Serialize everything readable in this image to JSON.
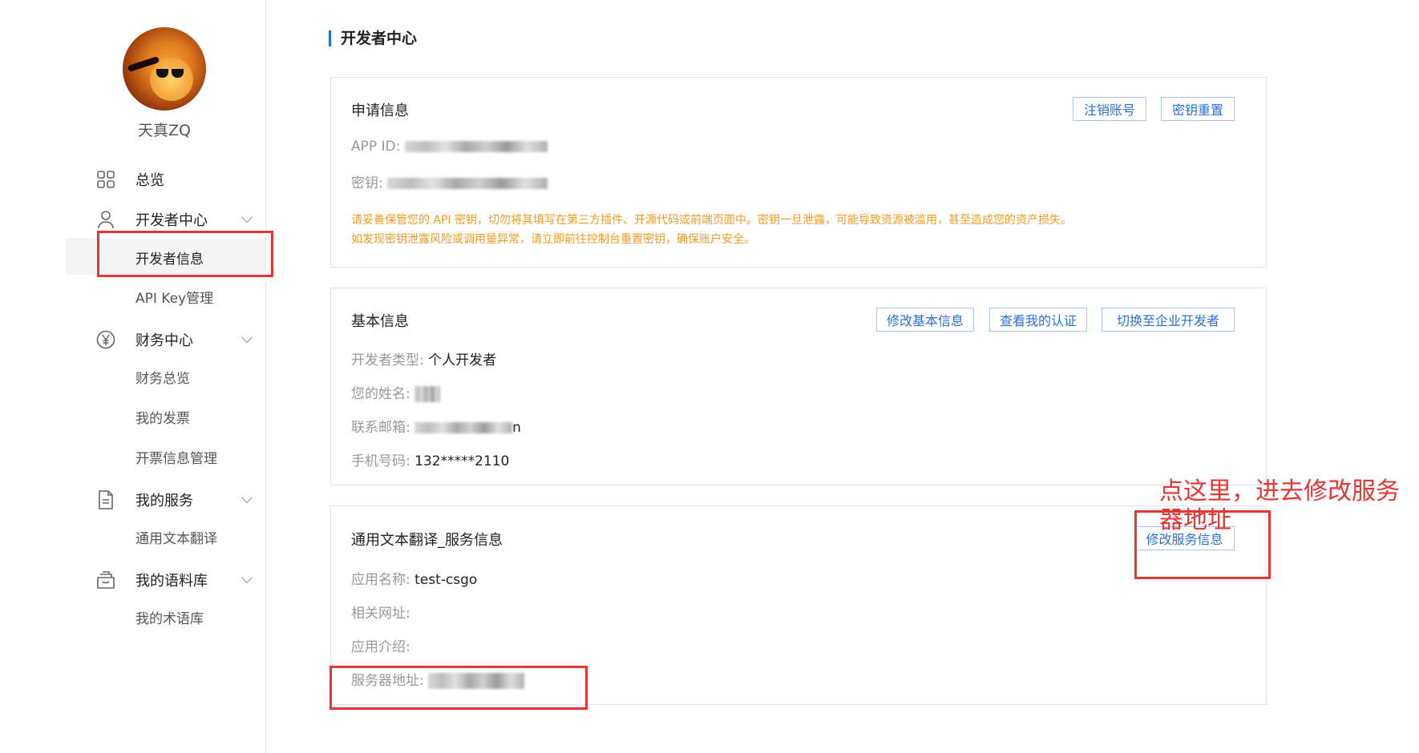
{
  "user": {
    "name": "天真ZQ"
  },
  "nav": {
    "overview": "总览",
    "developer_center": "开发者中心",
    "developer_info": "开发者信息",
    "api_key_mgmt": "API Key管理",
    "finance_center": "财务中心",
    "finance_overview": "财务总览",
    "my_invoices": "我的发票",
    "invoice_info_mgmt": "开票信息管理",
    "my_services": "我的服务",
    "general_text_translation": "通用文本翻译",
    "my_corpus": "我的语料库",
    "my_termbase": "我的术语库"
  },
  "page": {
    "title": "开发者中心"
  },
  "application": {
    "title": "申请信息",
    "app_id_label": "APP ID:",
    "secret_label": "密钥:",
    "btn_cancel_account": "注销账号",
    "btn_reset_key": "密钥重置",
    "warning_line1": "请妥善保管您的 API 密钥，切勿将其填写在第三方插件、开源代码或前端页面中。密钥一旦泄露，可能导致资源被滥用，甚至造成您的资产损失。",
    "warning_line2": "如发现密钥泄露风险或调用量异常，请立即前往控制台重置密钥，确保账户安全。"
  },
  "basic": {
    "title": "基本信息",
    "btn_edit_basic": "修改基本信息",
    "btn_view_cert": "查看我的认证",
    "btn_switch_enterprise": "切换至企业开发者",
    "type_label": "开发者类型:",
    "type_value": "个人开发者",
    "name_label": "您的姓名:",
    "email_label": "联系邮箱:",
    "email_tail": "n",
    "phone_label": "手机号码:",
    "phone_value": "132*****2110"
  },
  "service": {
    "title": "通用文本翻译_服务信息",
    "btn_edit_service": "修改服务信息",
    "app_name_label": "应用名称:",
    "app_name_value": "test-csgo",
    "related_url_label": "相关网址:",
    "app_intro_label": "应用介绍:",
    "server_addr_label": "服务器地址:"
  },
  "annotation": {
    "text": "点这里，进去修改服务器地址"
  },
  "colors": {
    "accent": "#1e6fe0",
    "warning": "#f39a1f",
    "highlight": "#e63535"
  }
}
